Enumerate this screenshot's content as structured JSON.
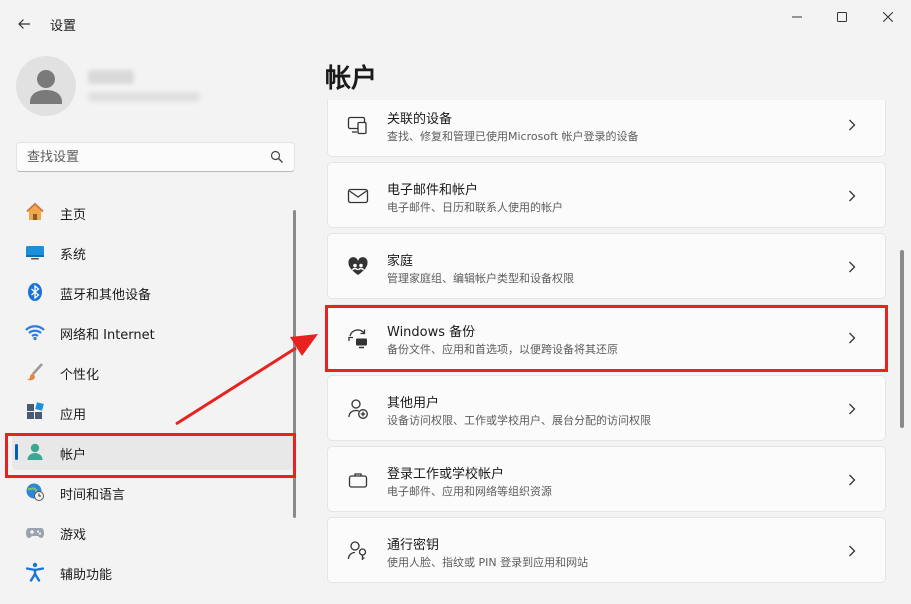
{
  "app": {
    "title": "设置"
  },
  "window": {
    "minimize": "minimize",
    "maximize": "maximize",
    "close": "close"
  },
  "profile": {
    "name": "(blurred)",
    "email": "(blurred)"
  },
  "search": {
    "placeholder": "查找设置"
  },
  "nav": {
    "items": [
      {
        "label": "主页",
        "icon": "home-icon"
      },
      {
        "label": "系统",
        "icon": "system-icon"
      },
      {
        "label": "蓝牙和其他设备",
        "icon": "bluetooth-icon"
      },
      {
        "label": "网络和 Internet",
        "icon": "wifi-icon"
      },
      {
        "label": "个性化",
        "icon": "brush-icon"
      },
      {
        "label": "应用",
        "icon": "apps-icon"
      },
      {
        "label": "帐户",
        "icon": "account-icon",
        "selected": true
      },
      {
        "label": "时间和语言",
        "icon": "globe-clock-icon"
      },
      {
        "label": "游戏",
        "icon": "gamepad-icon"
      },
      {
        "label": "辅助功能",
        "icon": "accessibility-icon"
      }
    ]
  },
  "main": {
    "title": "帐户",
    "cards": [
      {
        "title": "关联的设备",
        "subtitle": "查找、修复和管理已使用Microsoft 帐户登录的设备",
        "icon": "linked-devices-icon"
      },
      {
        "title": "电子邮件和帐户",
        "subtitle": "电子邮件、日历和联系人使用的帐户",
        "icon": "email-icon"
      },
      {
        "title": "家庭",
        "subtitle": "管理家庭组、编辑帐户类型和设备权限",
        "icon": "family-heart-icon"
      },
      {
        "title": "Windows 备份",
        "subtitle": "备份文件、应用和首选项，以便跨设备将其还原",
        "icon": "backup-icon",
        "highlighted": true
      },
      {
        "title": "其他用户",
        "subtitle": "设备访问权限、工作或学校用户、展台分配的访问权限",
        "icon": "add-person-icon"
      },
      {
        "title": "登录工作或学校帐户",
        "subtitle": "电子邮件、应用和网络等组织资源",
        "icon": "briefcase-icon"
      },
      {
        "title": "通行密钥",
        "subtitle": "使用人脸、指纹或 PIN 登录到应用和网站",
        "icon": "passkey-icon"
      }
    ]
  },
  "colors": {
    "accent": "#005fb8",
    "annotation": "#e8231f",
    "background": "#f3f3f3",
    "card": "#fbfbfb"
  }
}
